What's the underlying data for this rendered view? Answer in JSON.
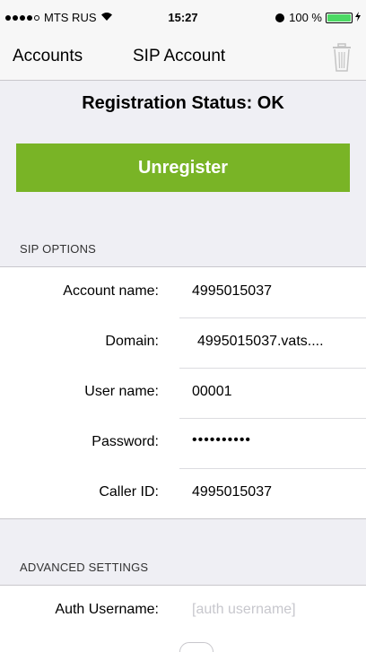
{
  "status_bar": {
    "carrier": "MTS RUS",
    "time": "15:27",
    "battery": "100 %"
  },
  "nav": {
    "back_label": "Accounts",
    "title": "SIP Account",
    "trash_icon": "trash-icon"
  },
  "registration": {
    "status_text": "Registration Status: OK",
    "unregister_label": "Unregister",
    "button_color": "#79b426"
  },
  "sip_options": {
    "header": "SIP OPTIONS",
    "rows": [
      {
        "label": "Account name:",
        "value": "4995015037"
      },
      {
        "label": "Domain:",
        "value": "4995015037.vats...."
      },
      {
        "label": "User name:",
        "value": "00001"
      },
      {
        "label": "Password:",
        "value": "••••••••••"
      },
      {
        "label": "Caller ID:",
        "value": "4995015037"
      }
    ]
  },
  "advanced": {
    "header": "ADVANCED SETTINGS",
    "auth_label": "Auth Username:",
    "auth_placeholder": "[auth username]"
  }
}
